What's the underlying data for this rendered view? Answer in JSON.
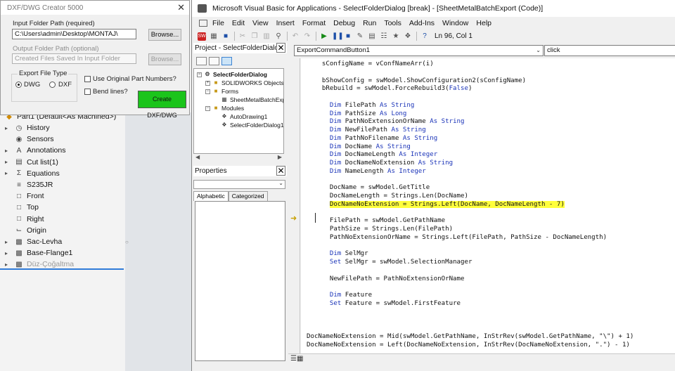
{
  "dxf_dialog": {
    "title": "DXF/DWG Creator 5000",
    "input_label": "Input Folder Path (required)",
    "input_value": "C:\\Users\\admin\\Desktop\\MONTAJ\\",
    "browse_label": "Browse...",
    "output_label": "Output Folder Path (optional)",
    "output_placeholder": "Created Files Saved In Input Folder",
    "browse2_label": "Browse...",
    "group_title": "Export File Type",
    "radio_dwg": "DWG",
    "radio_dxf": "DXF",
    "radio_selected": "DWG",
    "check_original": "Use Original Part Numbers?",
    "check_bend": "Bend lines?",
    "create_button": "Create DXF/DWG",
    "create_color": "#1bc41b"
  },
  "feature_tree": {
    "part_header": "Part1  (Default<As Machined>)",
    "items": [
      {
        "label": "History",
        "icon": "history-icon",
        "expand": true
      },
      {
        "label": "Sensors",
        "icon": "sensors-icon",
        "expand": false
      },
      {
        "label": "Annotations",
        "icon": "annotations-icon",
        "expand": true
      },
      {
        "label": "Cut list(1)",
        "icon": "cut-list-icon",
        "expand": true
      },
      {
        "label": "Equations",
        "icon": "equations-icon",
        "expand": true
      },
      {
        "label": "S235JR",
        "icon": "material-icon",
        "expand": false
      },
      {
        "label": "Front",
        "icon": "plane-icon",
        "expand": false
      },
      {
        "label": "Top",
        "icon": "plane-icon",
        "expand": false
      },
      {
        "label": "Right",
        "icon": "plane-icon",
        "expand": false
      },
      {
        "label": "Origin",
        "icon": "origin-icon",
        "expand": false
      },
      {
        "label": "Sac-Levha",
        "icon": "sheet-metal-icon",
        "expand": true
      },
      {
        "label": "Base-Flange1",
        "icon": "base-flange-icon",
        "expand": true
      },
      {
        "label": "Düz-Çoğaltma",
        "icon": "flatten-icon",
        "expand": true,
        "disabled": true
      }
    ]
  },
  "vba": {
    "title": "Microsoft Visual Basic for Applications - SelectFolderDialog [break] - [SheetMetalBatchExport (Code)]",
    "menu": [
      "File",
      "Edit",
      "View",
      "Insert",
      "Format",
      "Debug",
      "Run",
      "Tools",
      "Add-Ins",
      "Window",
      "Help"
    ],
    "status": "Ln 96, Col 1",
    "project_pane_title": "Project - SelectFolderDialog",
    "project_tree": {
      "root": "SelectFolderDialog",
      "solidworks_objects": "SOLIDWORKS Objects",
      "forms": "Forms",
      "form_item": "SheetMetalBatchExport",
      "modules": "Modules",
      "module1": "AutoDrawing1",
      "module2": "SelectFolderDialog1"
    },
    "properties_title": "Properties",
    "prop_tabs": [
      "Alphabetic",
      "Categorized"
    ],
    "object_combo": "ExportCommandButton1",
    "proc_combo": "click",
    "code_lines": [
      [
        {
          "t": "    sConfigName = vConfNameArr(i)"
        }
      ],
      [
        {
          "t": ""
        }
      ],
      [
        {
          "t": "    bShowConfig = swModel.ShowConfiguration2(sConfigName)"
        }
      ],
      [
        {
          "t": "    bRebuild = swModel.ForceRebuild3("
        },
        {
          "t": "False",
          "c": "kw"
        },
        {
          "t": ")"
        }
      ],
      [
        {
          "t": ""
        }
      ],
      [
        {
          "t": "      "
        },
        {
          "t": "Dim",
          "c": "kw"
        },
        {
          "t": " FilePath "
        },
        {
          "t": "As String",
          "c": "kw"
        }
      ],
      [
        {
          "t": "      "
        },
        {
          "t": "Dim",
          "c": "kw"
        },
        {
          "t": " PathSize "
        },
        {
          "t": "As Long",
          "c": "kw"
        }
      ],
      [
        {
          "t": "      "
        },
        {
          "t": "Dim",
          "c": "kw"
        },
        {
          "t": " PathNoExtensionOrName "
        },
        {
          "t": "As String",
          "c": "kw"
        }
      ],
      [
        {
          "t": "      "
        },
        {
          "t": "Dim",
          "c": "kw"
        },
        {
          "t": " NewFilePath "
        },
        {
          "t": "As String",
          "c": "kw"
        }
      ],
      [
        {
          "t": "      "
        },
        {
          "t": "Dim",
          "c": "kw"
        },
        {
          "t": " PathNoFilename "
        },
        {
          "t": "As String",
          "c": "kw"
        }
      ],
      [
        {
          "t": "      "
        },
        {
          "t": "Dim",
          "c": "kw"
        },
        {
          "t": " DocName "
        },
        {
          "t": "As String",
          "c": "kw"
        }
      ],
      [
        {
          "t": "      "
        },
        {
          "t": "Dim",
          "c": "kw"
        },
        {
          "t": " DocNameLength "
        },
        {
          "t": "As Integer",
          "c": "kw"
        }
      ],
      [
        {
          "t": "      "
        },
        {
          "t": "Dim",
          "c": "kw"
        },
        {
          "t": " DocNameNoExtension "
        },
        {
          "t": "As String",
          "c": "kw"
        }
      ],
      [
        {
          "t": "      "
        },
        {
          "t": "Dim",
          "c": "kw"
        },
        {
          "t": " NameLength "
        },
        {
          "t": "As Integer",
          "c": "kw"
        }
      ],
      [
        {
          "t": ""
        }
      ],
      [
        {
          "t": "      DocName = swModel.GetTitle"
        }
      ],
      [
        {
          "t": "      DocNameLength = Strings.Len(DocName)"
        }
      ],
      [
        {
          "t": "      "
        },
        {
          "t": "DocNameNoExtension = Strings.Left(DocName, DocNameLength - 7)",
          "c": "hl"
        }
      ],
      [
        {
          "t": ""
        }
      ],
      [
        {
          "t": "      FilePath = swModel.GetPathName"
        }
      ],
      [
        {
          "t": "      PathSize = Strings.Len(FilePath)"
        }
      ],
      [
        {
          "t": "      PathNoExtensionOrName = Strings.Left(FilePath, PathSize - DocNameLength)"
        }
      ],
      [
        {
          "t": ""
        }
      ],
      [
        {
          "t": "      "
        },
        {
          "t": "Dim",
          "c": "kw"
        },
        {
          "t": " SelMgr"
        }
      ],
      [
        {
          "t": "      "
        },
        {
          "t": "Set",
          "c": "kw"
        },
        {
          "t": " SelMgr = swModel.SelectionManager"
        }
      ],
      [
        {
          "t": ""
        }
      ],
      [
        {
          "t": "      NewFilePath = PathNoExtensionOrName"
        }
      ],
      [
        {
          "t": ""
        }
      ],
      [
        {
          "t": "      "
        },
        {
          "t": "Dim",
          "c": "kw"
        },
        {
          "t": " Feature"
        }
      ],
      [
        {
          "t": "      "
        },
        {
          "t": "Set",
          "c": "kw"
        },
        {
          "t": " Feature = swModel.FirstFeature"
        }
      ],
      [
        {
          "t": ""
        }
      ],
      [
        {
          "t": ""
        }
      ],
      [
        {
          "t": ""
        }
      ],
      [
        {
          "t": "DocNameNoExtension = Mid(swModel.GetPathName, InStrRev(swModel.GetPathName, \"\\\") + 1)"
        }
      ],
      [
        {
          "t": "DocNameNoExtension = Left(DocNameNoExtension, InStrRev(DocNameNoExtension, \".\") - 1)"
        }
      ]
    ]
  }
}
